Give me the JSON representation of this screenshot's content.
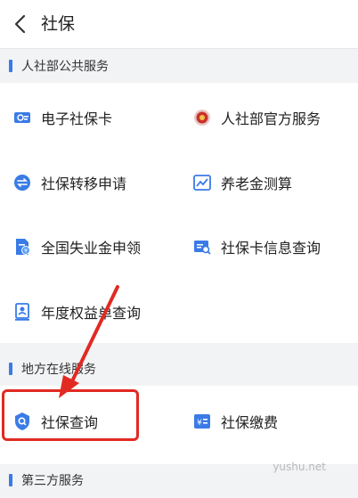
{
  "header": {
    "title": "社保"
  },
  "sections": [
    {
      "title": "人社部公共服务",
      "items": [
        {
          "label": "电子社保卡",
          "icon": "id-card-icon"
        },
        {
          "label": "人社部官方服务",
          "icon": "ministry-emblem-icon"
        },
        {
          "label": "社保转移申请",
          "icon": "transfer-icon"
        },
        {
          "label": "养老金测算",
          "icon": "chart-icon"
        },
        {
          "label": "全国失业金申领",
          "icon": "document-yen-icon"
        },
        {
          "label": "社保卡信息查询",
          "icon": "card-search-icon"
        },
        {
          "label": "年度权益单查询",
          "icon": "person-doc-icon"
        }
      ]
    },
    {
      "title": "地方在线服务",
      "items": [
        {
          "label": "社保查询",
          "icon": "shield-search-icon"
        },
        {
          "label": "社保缴费",
          "icon": "payment-icon"
        }
      ]
    },
    {
      "title": "第三方服务"
    }
  ],
  "watermark": "yushu.net",
  "colors": {
    "accent": "#3a7be6",
    "annotation": "#e12a22"
  }
}
